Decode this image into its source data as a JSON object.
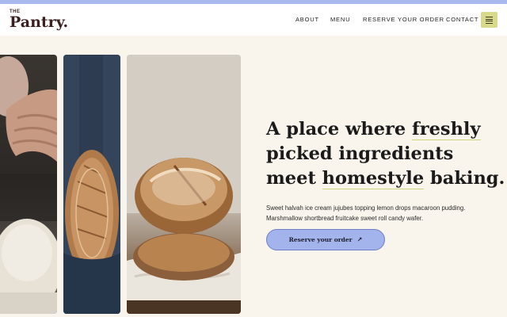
{
  "header": {
    "logo_small": "THE",
    "logo_name": "Pantry.",
    "nav": [
      {
        "label": "ABOUT"
      },
      {
        "label": "MENU"
      },
      {
        "label": "RESERVE YOUR ORDER"
      },
      {
        "label": "CONTACT"
      }
    ]
  },
  "hero": {
    "headline_lines": [
      {
        "before": "A place where ",
        "highlight": "freshly",
        "after": ""
      },
      {
        "before": "picked ingredients",
        "highlight": "",
        "after": ""
      },
      {
        "before": "meet ",
        "highlight": "homestyle",
        "after": " baking."
      }
    ],
    "description_lines": [
      "Sweet halvah ice cream jujubes topping lemon drops macaroon pudding.",
      "Marshmallow shortbread fruitcake sweet roll candy wafer."
    ],
    "cta_label": "Reserve your order",
    "cta_icon": "arrow-up-right-icon"
  },
  "images": [
    {
      "name": "hands-kneading-dough-photo"
    },
    {
      "name": "person-holding-bread-loaf-photo"
    },
    {
      "name": "stacked-sourdough-loaves-photo"
    }
  ],
  "colors": {
    "accent_bar": "#a9b8ee",
    "background": "#f9f5ec",
    "menu_button": "#d8d98a",
    "underline": "#cdd47a",
    "cta_fill": "#a3b3ec",
    "logo": "#3a1f1f"
  }
}
